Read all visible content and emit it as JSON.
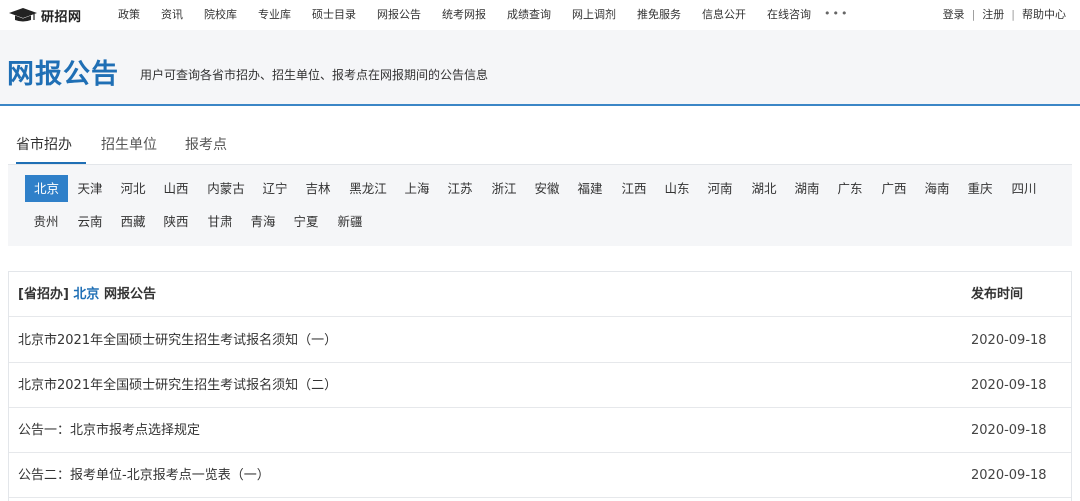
{
  "header": {
    "logo_text": "研招网",
    "nav_items": [
      "政策",
      "资讯",
      "院校库",
      "专业库",
      "硕士目录",
      "网报公告",
      "统考网报",
      "成绩查询",
      "网上调剂",
      "推免服务",
      "信息公开",
      "在线咨询"
    ],
    "more": "•••",
    "login": "登录",
    "register": "注册",
    "help": "帮助中心",
    "separator": "|"
  },
  "page": {
    "title": "网报公告",
    "description": "用户可查询各省市招办、招生单位、报考点在网报期间的公告信息"
  },
  "tabs": [
    "省市招办",
    "招生单位",
    "报考点"
  ],
  "active_tab": "省市招办",
  "provinces": [
    "北京",
    "天津",
    "河北",
    "山西",
    "内蒙古",
    "辽宁",
    "吉林",
    "黑龙江",
    "上海",
    "江苏",
    "浙江",
    "安徽",
    "福建",
    "江西",
    "山东",
    "河南",
    "湖北",
    "湖南",
    "广东",
    "广西",
    "海南",
    "重庆",
    "四川",
    "贵州",
    "云南",
    "西藏",
    "陕西",
    "甘肃",
    "青海",
    "宁夏",
    "新疆"
  ],
  "active_province": "北京",
  "table": {
    "header_prefix": "[省招办]",
    "header_province": "北京",
    "header_suffix": "网报公告",
    "date_header": "发布时间",
    "rows": [
      {
        "title": "北京市2021年全国硕士研究生招生考试报名须知（一）",
        "date": "2020-09-18"
      },
      {
        "title": "北京市2021年全国硕士研究生招生考试报名须知（二）",
        "date": "2020-09-18"
      },
      {
        "title": "公告一：北京市报考点选择规定",
        "date": "2020-09-18"
      },
      {
        "title": "公告二：报考单位-北京报考点一览表（一）",
        "date": "2020-09-18"
      }
    ]
  },
  "colors": {
    "accent": "#1f6fb5",
    "active_bg": "#2f80c9",
    "panel_bg": "#f5f6f8"
  }
}
